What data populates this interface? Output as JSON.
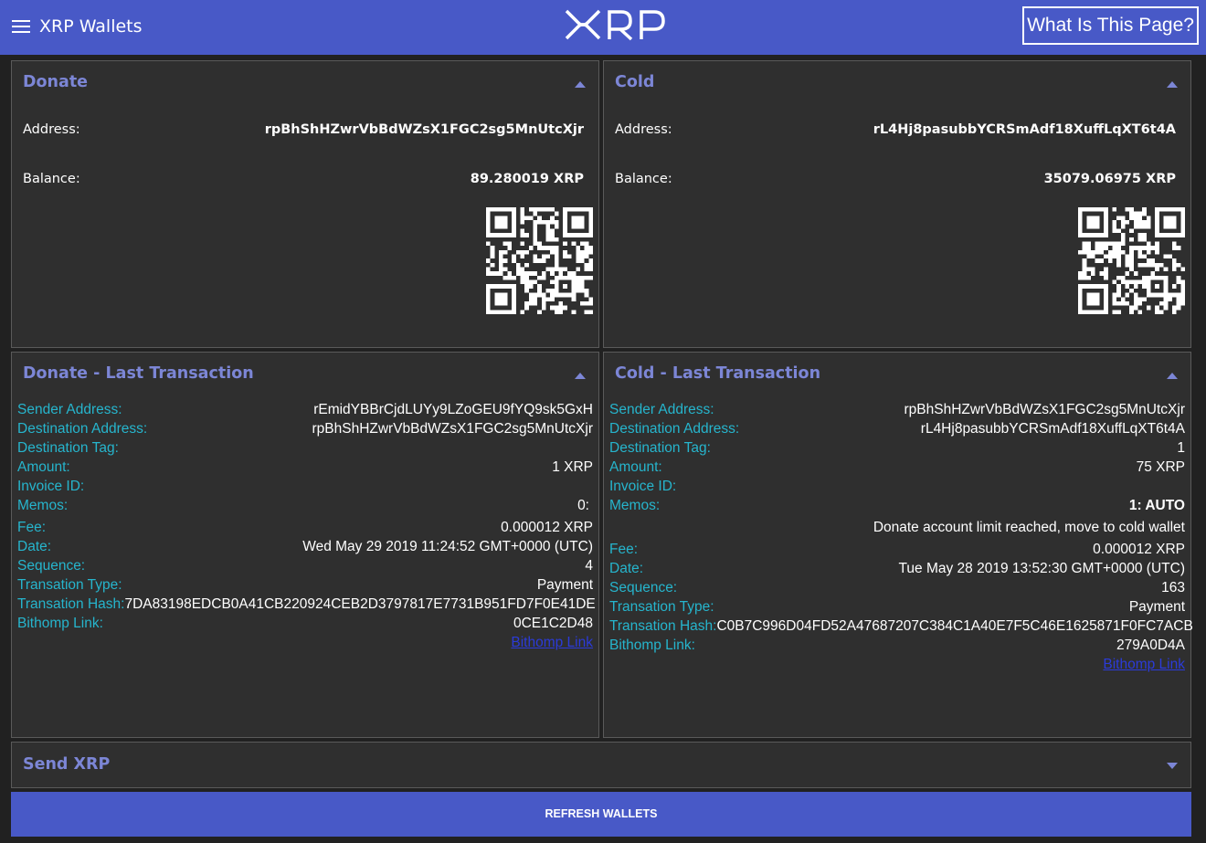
{
  "header": {
    "app_title": "XRP Wallets",
    "logo_text": "XRP",
    "info_button": "What Is This Page?",
    "bar_color": "#4859c7"
  },
  "wallets": [
    {
      "title": "Donate",
      "address_label": "Address:",
      "address": "rpBhShHZwrVbBdWZsX1FGC2sg5MnUtcXjr",
      "balance_label": "Balance:",
      "balance": "89.280019 XRP"
    },
    {
      "title": "Cold",
      "address_label": "Address:",
      "address": "rL4Hj8pasubbYCRSmAdf18XuffLqXT6t4A",
      "balance_label": "Balance:",
      "balance": "35079.06975 XRP"
    }
  ],
  "transactions": [
    {
      "title": "Donate - Last Transaction",
      "sender_label": "Sender Address:",
      "sender": "rEmidYBBrCjdLUYy9LZoGEU9fYQ9sk5GxH",
      "dest_label": "Destination Address:",
      "dest": "rpBhShHZwrVbBdWZsX1FGC2sg5MnUtcXjr",
      "tag_label": "Destination Tag:",
      "tag": "",
      "amount_label": "Amount:",
      "amount": "1 XRP",
      "invoice_label": "Invoice ID:",
      "invoice": "",
      "memos_label": "Memos:",
      "memo_head": "0:",
      "memo_text": "",
      "fee_label": "Fee:",
      "fee": "0.000012 XRP",
      "date_label": "Date:",
      "date": "Wed May 29 2019 11:24:52 GMT+0000 (UTC)",
      "seq_label": "Sequence:",
      "seq": "4",
      "type_label": "Transation Type:",
      "type": "Payment",
      "hash_label": "Transation Hash:",
      "hash_1": "7DA83198EDCB0A41CB220924CEB2D3797817E7731B951FD7F0E41DE",
      "hash_2": "0CE1C2D48",
      "link_label": "Bithomp Link:",
      "link": "Bithomp Link"
    },
    {
      "title": "Cold - Last Transaction",
      "sender_label": "Sender Address:",
      "sender": "rpBhShHZwrVbBdWZsX1FGC2sg5MnUtcXjr",
      "dest_label": "Destination Address:",
      "dest": "rL4Hj8pasubbYCRSmAdf18XuffLqXT6t4A",
      "tag_label": "Destination Tag:",
      "tag": "1",
      "amount_label": "Amount:",
      "amount": "75 XRP",
      "invoice_label": "Invoice ID:",
      "invoice": "",
      "memos_label": "Memos:",
      "memo_head": "1: AUTO",
      "memo_text": "Donate account limit reached, move to cold wallet",
      "fee_label": "Fee:",
      "fee": "0.000012 XRP",
      "date_label": "Date:",
      "date": "Tue May 28 2019 13:52:30 GMT+0000 (UTC)",
      "seq_label": "Sequence:",
      "seq": "163",
      "type_label": "Transation Type:",
      "type": "Payment",
      "hash_label": "Transation Hash:",
      "hash_1": "C0B7C996D04FD52A47687207C384C1A40E7F5C46E1625871F0FC7ACB",
      "hash_2": "279A0D4A",
      "link_label": "Bithomp Link:",
      "link": "Bithomp Link"
    }
  ],
  "send": {
    "title": "Send XRP"
  },
  "refresh_button": "REFRESH WALLETS",
  "colors": {
    "accent": "#4859c7",
    "panel_title": "#7c86d6",
    "field_label": "#26b5cd",
    "link": "#2b3bd9",
    "panel_bg": "#2f2f2f",
    "page_bg": "#212121"
  }
}
